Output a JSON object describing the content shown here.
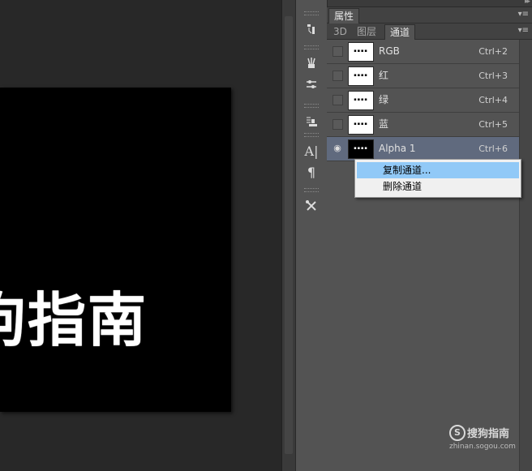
{
  "canvas": {
    "text": "狗指南"
  },
  "panel": {
    "top_tabs": [
      "属性"
    ],
    "sub_tabs": [
      "3D",
      "图层",
      "通道"
    ],
    "active_sub_tab": "通道"
  },
  "channels": [
    {
      "name": "RGB",
      "shortcut": "Ctrl+2"
    },
    {
      "name": "红",
      "shortcut": "Ctrl+3"
    },
    {
      "name": "绿",
      "shortcut": "Ctrl+4"
    },
    {
      "name": "蓝",
      "shortcut": "Ctrl+5"
    },
    {
      "name": "Alpha 1",
      "shortcut": "Ctrl+6"
    }
  ],
  "context_menu": {
    "items": [
      "复制通道...",
      "删除通道"
    ]
  },
  "watermark": {
    "logo": "S",
    "brand": "搜狗指南",
    "url": "zhinan.sogou.com"
  },
  "icons": {
    "dock": "double-chevron-icon",
    "panel_menu": "panel-menu-icon",
    "eye": "eye-icon"
  }
}
